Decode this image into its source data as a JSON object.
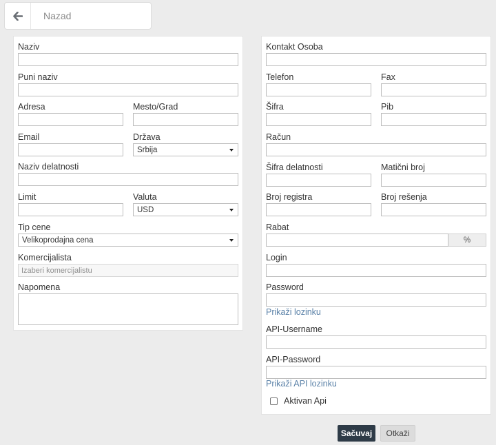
{
  "header": {
    "back_label": "Nazad",
    "back_icon": "arrow-left-icon"
  },
  "left": {
    "naziv": {
      "label": "Naziv",
      "value": ""
    },
    "puni_naziv": {
      "label": "Puni naziv",
      "value": ""
    },
    "adresa": {
      "label": "Adresa",
      "value": ""
    },
    "mesto": {
      "label": "Mesto/Grad",
      "value": ""
    },
    "email": {
      "label": "Email",
      "value": ""
    },
    "drzava": {
      "label": "Država",
      "selected": "Srbija"
    },
    "naziv_delatnosti": {
      "label": "Naziv delatnosti",
      "value": ""
    },
    "limit": {
      "label": "Limit",
      "value": ""
    },
    "valuta": {
      "label": "Valuta",
      "selected": "USD"
    },
    "tip_cene": {
      "label": "Tip cene",
      "selected": "Velikoprodajna cena"
    },
    "komercijalista": {
      "label": "Komercijalista",
      "placeholder": "Izaberi komercijalistu"
    },
    "napomena": {
      "label": "Napomena",
      "value": ""
    }
  },
  "right": {
    "kontakt": {
      "label": "Kontakt Osoba",
      "value": ""
    },
    "telefon": {
      "label": "Telefon",
      "value": ""
    },
    "fax": {
      "label": "Fax",
      "value": ""
    },
    "sifra": {
      "label": "Šifra",
      "value": ""
    },
    "pib": {
      "label": "Pib",
      "value": ""
    },
    "racun": {
      "label": "Račun",
      "value": ""
    },
    "sifra_delatnosti": {
      "label": "Šifra delatnosti",
      "value": ""
    },
    "maticni_broj": {
      "label": "Matični broj",
      "value": ""
    },
    "broj_registra": {
      "label": "Broj registra",
      "value": ""
    },
    "broj_resenja": {
      "label": "Broj rešenja",
      "value": ""
    },
    "rabat": {
      "label": "Rabat",
      "value": "",
      "addon": "%"
    },
    "login": {
      "label": "Login",
      "value": ""
    },
    "password": {
      "label": "Password",
      "value": "",
      "show_link": "Prikaži lozinku"
    },
    "api_username": {
      "label": "API-Username",
      "value": ""
    },
    "api_password": {
      "label": "API-Password",
      "value": "",
      "show_link": "Prikaži API lozinku"
    },
    "aktivan_api": {
      "label": "Aktivan Api",
      "checked": false
    }
  },
  "footer": {
    "save_label": "Sačuvaj",
    "cancel_label": "Otkaži"
  }
}
